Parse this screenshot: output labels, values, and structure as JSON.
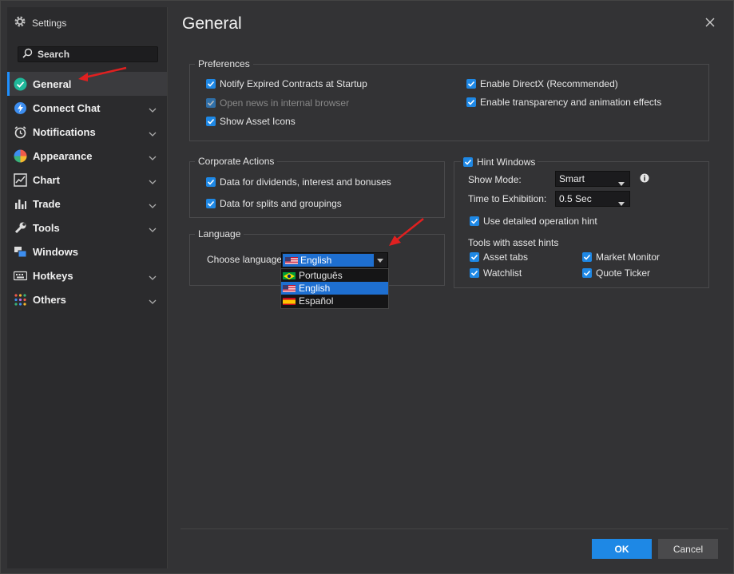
{
  "window": {
    "title": "Settings"
  },
  "sidebar": {
    "search_placeholder": "Search",
    "items": [
      {
        "label": "General",
        "icon": "check-circle-icon",
        "active": true,
        "expandable": false
      },
      {
        "label": "Connect Chat",
        "icon": "chat-icon",
        "expandable": true
      },
      {
        "label": "Notifications",
        "icon": "alarm-clock-icon",
        "expandable": true
      },
      {
        "label": "Appearance",
        "icon": "color-wheel-icon",
        "expandable": true
      },
      {
        "label": "Chart",
        "icon": "chart-icon",
        "expandable": true
      },
      {
        "label": "Trade",
        "icon": "trade-icon",
        "expandable": true
      },
      {
        "label": "Tools",
        "icon": "wrench-icon",
        "expandable": true
      },
      {
        "label": "Windows",
        "icon": "windows-icon",
        "expandable": false
      },
      {
        "label": "Hotkeys",
        "icon": "keyboard-icon",
        "expandable": true
      },
      {
        "label": "Others",
        "icon": "grid-dots-icon",
        "expandable": true
      }
    ]
  },
  "main": {
    "title": "General",
    "preferences": {
      "legend": "Preferences",
      "options": [
        {
          "label": "Notify Expired Contracts at Startup",
          "checked": true
        },
        {
          "label": "Open news in internal browser",
          "checked": true,
          "disabled": true
        },
        {
          "label": "Show Asset Icons",
          "checked": true
        },
        {
          "label": "Enable DirectX (Recommended)",
          "checked": true
        },
        {
          "label": "Enable transparency and animation effects",
          "checked": true
        }
      ]
    },
    "corporate_actions": {
      "legend": "Corporate Actions",
      "options": [
        {
          "label": "Data for dividends, interest and bonuses",
          "checked": true
        },
        {
          "label": "Data for splits and groupings",
          "checked": true
        }
      ]
    },
    "language": {
      "legend": "Language",
      "choose_label": "Choose language:",
      "selected": "English",
      "options": [
        "Português",
        "English",
        "Español"
      ]
    },
    "hint_windows": {
      "legend": "Hint Windows",
      "checked": true,
      "show_mode_label": "Show Mode:",
      "show_mode_value": "Smart",
      "time_label": "Time to Exhibition:",
      "time_value": "0.5 Sec",
      "detailed_hint": "Use detailed operation hint",
      "tools_label": "Tools with asset hints",
      "tools": [
        "Asset tabs",
        "Market Monitor",
        "Watchlist",
        "Quote Ticker"
      ]
    }
  },
  "footer": {
    "ok_label": "OK",
    "cancel_label": "Cancel"
  },
  "colors": {
    "accent": "#1e88e5",
    "background": "#333335",
    "sidebar": "#2b2b2d",
    "annotation_arrow": "#e02020"
  }
}
